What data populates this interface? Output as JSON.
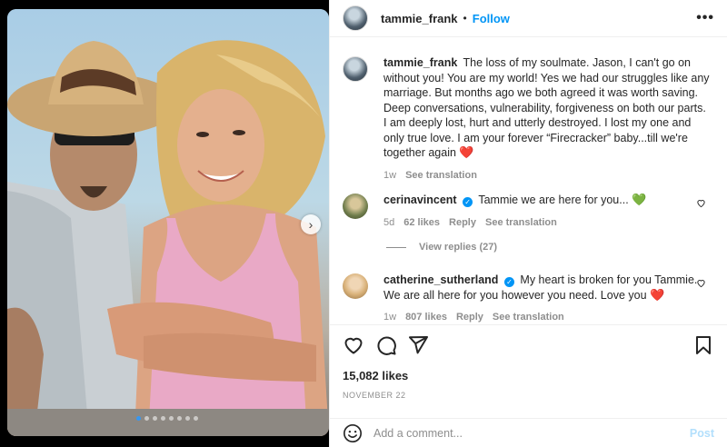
{
  "post": {
    "author": "tammie_frank",
    "separator": "•",
    "follow_label": "Follow",
    "more_label": "•••",
    "next_label": "›",
    "carousel": {
      "count": 8,
      "active": 0
    }
  },
  "caption": {
    "username": "tammie_frank",
    "text": "The loss of my soulmate. Jason, I can't go on without you! You are my world! Yes we had our struggles like any marriage. But months ago we both agreed it was worth saving. Deep conversations, vulnerability, forgiveness on both our parts. I am deeply lost, hurt and utterly destroyed. I lost my one and only true love. I am your forever “Firecracker” baby...till we're together again",
    "emoji": "❤️",
    "time": "1w",
    "see_translation": "See translation"
  },
  "comments": [
    {
      "username": "cerinavincent",
      "verified": true,
      "text": "Tammie we are here for you...",
      "emoji": "💚",
      "time": "5d",
      "likes": "62 likes",
      "reply": "Reply",
      "see_translation": "See translation"
    },
    {
      "username": "catherine_sutherland",
      "verified": true,
      "text": "My heart is broken for you Tammie. We are all here for you however you need. Love you",
      "emoji": "❤️",
      "time": "1w",
      "likes": "807 likes",
      "reply": "Reply",
      "see_translation": "See translation"
    }
  ],
  "view_replies": "View replies (27)",
  "likes_count": "15,082 likes",
  "date": "NOVEMBER 22",
  "add_comment": {
    "placeholder": "Add a comment...",
    "post_label": "Post"
  },
  "icons": {
    "like": "heart-outline-icon",
    "comment": "comment-bubble-icon",
    "share": "paper-plane-icon",
    "save": "bookmark-icon",
    "emoji": "smiley-face-icon",
    "comment_like": "small-heart-icon",
    "verified": "verified-badge-icon"
  },
  "colors": {
    "link_blue": "#0095f6",
    "muted_text": "#8e8e8e",
    "post_disabled": "#b2dffc",
    "divider": "#efefef"
  }
}
